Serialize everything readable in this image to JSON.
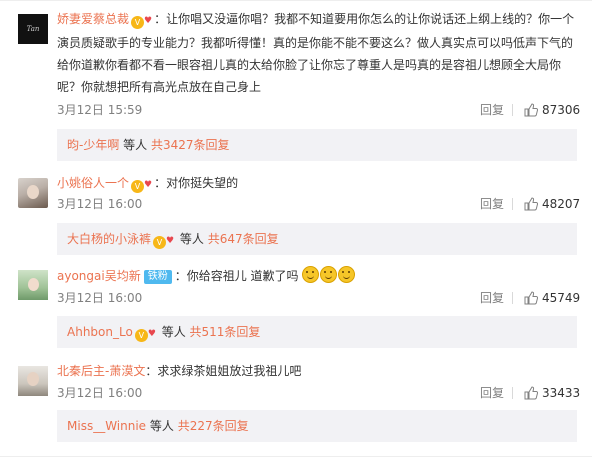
{
  "comments": [
    {
      "username": "娇妻爱蔡总裁",
      "vip": true,
      "colon": "：",
      "text": "让你唱又没逼你唱？我都不知道要用你怎么的让你说话还上纲上线的？你一个演员质疑歌手的专业能力？我都听得懂！真的是你能不能不要这么？做人真实点可以吗低声下气的给你道歉你看都不看一眼容祖儿真的太给你脸了让你忘了尊重人是吗真的是容祖儿想顾全大局你呢？你就想把所有高光点放在自己身上",
      "time": "3月12日 15:59",
      "reply_label": "回复",
      "likes": "87306",
      "sub": {
        "name": "昀-少年啊",
        "mid": " 等人 ",
        "count": "共3427条回复"
      },
      "avatar": "avatar-black-logo",
      "avatar_text": "Tan"
    },
    {
      "username": "小姚俗人一个",
      "vip": true,
      "colon": "：",
      "text": "对你挺失望的",
      "time": "3月12日 16:00",
      "reply_label": "回复",
      "likes": "48207",
      "sub": {
        "name": "大白杨的小泳裤",
        "mid": " 等人 ",
        "count": "共647条回复"
      },
      "avatar": "avatar-portrait"
    },
    {
      "username": "ayongai吴均新",
      "fan_badge": "铁粉",
      "colon": "：",
      "text": "你给容祖儿 道歉了吗",
      "time": "3月12日 16:00",
      "reply_label": "回复",
      "likes": "45749",
      "sub": {
        "name": "Ahhbon_Lo",
        "mid": " 等人 ",
        "count": "共511条回复"
      },
      "avatar": "avatar-green-portrait"
    },
    {
      "username": "北秦后主-萧漠文",
      "colon": "：",
      "text": "求求绿茶姐姐放过我祖儿吧",
      "time": "3月12日 16:00",
      "reply_label": "回复",
      "likes": "33433",
      "sub": {
        "name": "Miss__Winnie",
        "mid": " 等人 ",
        "count": "共227条回复"
      },
      "avatar": "avatar-portrait-grey"
    }
  ],
  "icons": {
    "like": "thumbs-up-icon",
    "vip": "vip-crown-icon",
    "heart": "heart-badge-icon",
    "emoji": "smile-emoji-icon"
  },
  "colors": {
    "username": "#eb7350",
    "meta": "#808080",
    "sub_bg": "#f2f2f5"
  }
}
